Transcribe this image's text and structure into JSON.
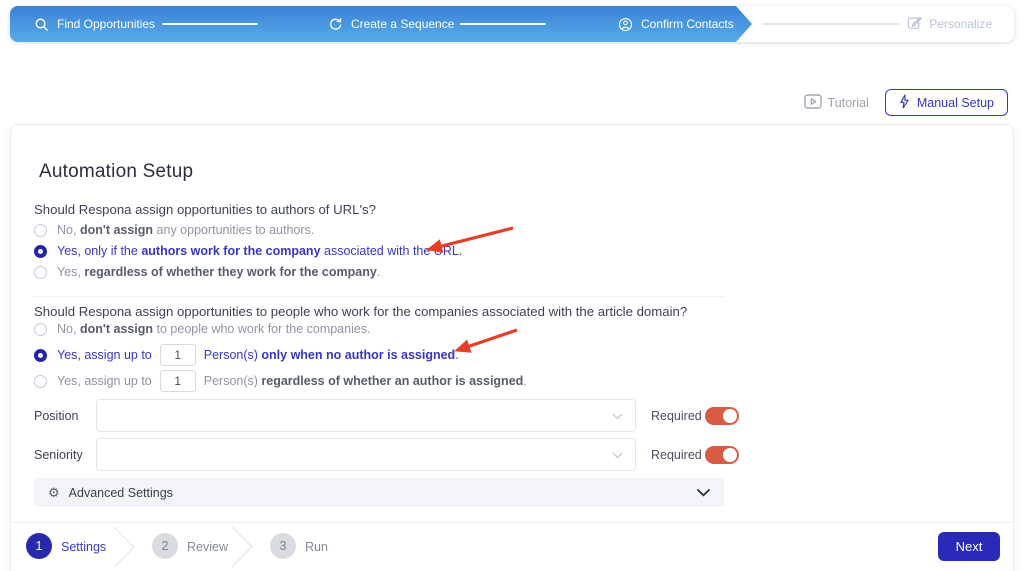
{
  "top_stepper": {
    "steps": [
      {
        "label": "Find Opportunities",
        "icon": "search"
      },
      {
        "label": "Create a Sequence",
        "icon": "sequence"
      },
      {
        "label": "Confirm Contacts",
        "icon": "contact"
      }
    ],
    "upcoming_step": {
      "label": "Personalize",
      "icon": "pencil-square"
    }
  },
  "header_actions": {
    "tutorial_label": "Tutorial",
    "manual_setup_label": "Manual Setup"
  },
  "card": {
    "title": "Automation Setup",
    "question1": {
      "text": "Should Respona assign opportunities to authors of URL's?",
      "options": [
        {
          "prefix": "No, ",
          "bold": "don't assign",
          "suffix": " any opportunities to authors."
        },
        {
          "prefix": "Yes, only if the ",
          "bold": "authors work for the company",
          "suffix": " associated with the URL."
        },
        {
          "prefix": "Yes, ",
          "bold": "regardless of whether they work for the company",
          "suffix": "."
        }
      ]
    },
    "question2": {
      "text": "Should Respona assign opportunities to people who work for the companies associated with the article domain?",
      "options": [
        {
          "prefix": "No, ",
          "bold": "don't assign",
          "suffix": " to people who work for the companies."
        },
        {
          "prefix": "Yes, assign up to",
          "input_value": "1",
          "mid": "Person(s) ",
          "bold": "only when no author is assigned",
          "suffix": "."
        },
        {
          "prefix": "Yes, assign up to",
          "input_value": "1",
          "mid": "Person(s) ",
          "bold": "regardless of whether an author is assigned",
          "suffix": "."
        }
      ]
    },
    "fields": [
      {
        "label": "Position",
        "required_label": "Required"
      },
      {
        "label": "Seniority",
        "required_label": "Required"
      }
    ],
    "advanced_settings_label": "Advanced Settings"
  },
  "bottom_stepper": {
    "steps": [
      {
        "number": "1",
        "label": "Settings"
      },
      {
        "number": "2",
        "label": "Review"
      },
      {
        "number": "3",
        "label": "Run"
      }
    ],
    "next_label": "Next"
  },
  "colors": {
    "accent_blue": "#2a2ab9",
    "toggle_orange": "#d85b43",
    "arrow_red": "#e93d25"
  }
}
